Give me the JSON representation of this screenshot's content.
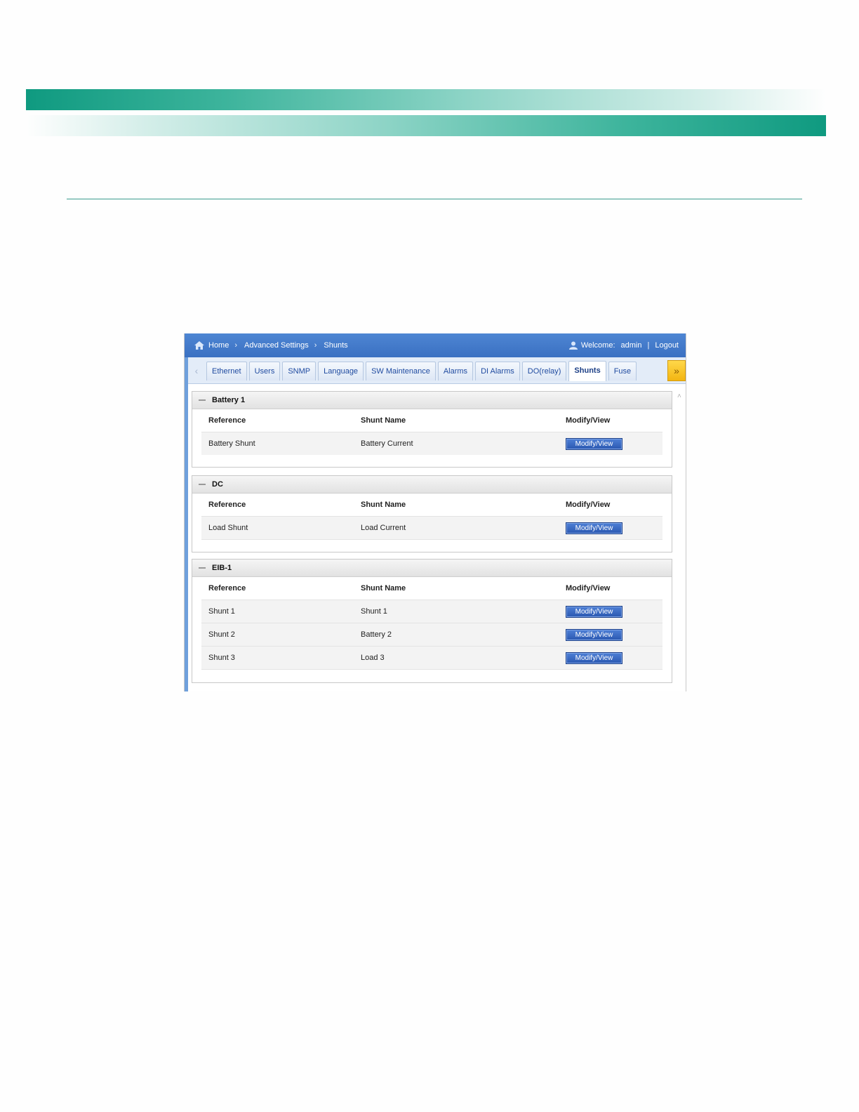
{
  "breadcrumb": [
    "Home",
    "Advanced Settings",
    "Shunts"
  ],
  "header": {
    "welcome": "Welcome:",
    "user": "admin",
    "divider": "|",
    "logout": "Logout"
  },
  "tabs": [
    "Ethernet",
    "Users",
    "SNMP",
    "Language",
    "SW Maintenance",
    "Alarms",
    "DI Alarms",
    "DO(relay)",
    "Shunts",
    "Fuse"
  ],
  "active_tab": "Shunts",
  "columns": {
    "reference": "Reference",
    "shunt_name": "Shunt Name",
    "modify": "Modify/View"
  },
  "button_label": "Modify/View",
  "groups": [
    {
      "title": "Battery 1",
      "rows": [
        {
          "reference": "Battery Shunt",
          "name": "Battery Current"
        }
      ]
    },
    {
      "title": "DC",
      "rows": [
        {
          "reference": "Load Shunt",
          "name": "Load Current"
        }
      ]
    },
    {
      "title": "EIB-1",
      "rows": [
        {
          "reference": "Shunt 1",
          "name": "Shunt 1"
        },
        {
          "reference": "Shunt 2",
          "name": "Battery 2"
        },
        {
          "reference": "Shunt 3",
          "name": "Load 3"
        }
      ]
    }
  ],
  "colors": {
    "band": "#0f9a80",
    "topbar": "#3a70c2",
    "button": "#2a57b0",
    "arrow": "#f3b512"
  }
}
